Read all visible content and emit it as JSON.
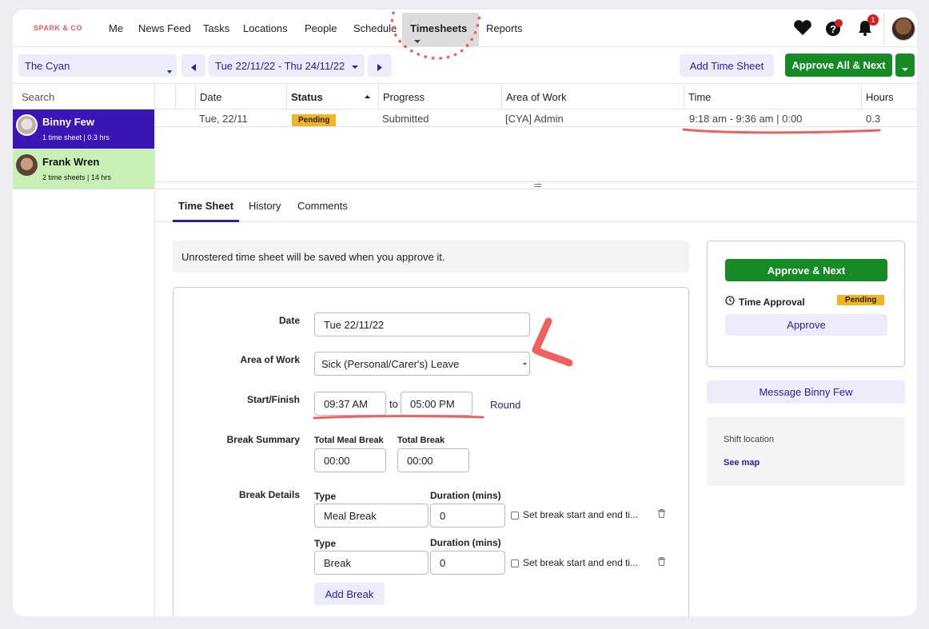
{
  "brand": "SPARK & CO",
  "nav": [
    "Me",
    "News Feed",
    "Tasks",
    "Locations",
    "People",
    "Schedule",
    "Timesheets",
    "Reports"
  ],
  "nav_active": "Timesheets",
  "notifications_count": "1",
  "toolbar": {
    "location": "The Cyan",
    "date_range": "Tue 22/11/22 - Thu 24/11/22",
    "add_time_sheet": "Add Time Sheet",
    "approve_all_next": "Approve All & Next"
  },
  "search_label": "Search",
  "people": [
    {
      "name": "Binny Few",
      "summary": "1 time sheet | 0.3 hrs"
    },
    {
      "name": "Frank Wren",
      "summary": "2 time sheets | 14 hrs"
    }
  ],
  "grid": {
    "headers": [
      "Date",
      "Status",
      "Progress",
      "Area of Work",
      "Time",
      "Hours"
    ],
    "row": {
      "date": "Tue, 22/11",
      "status": "Pending",
      "progress": "Submitted",
      "area": "[CYA] Admin",
      "time": "9:18 am - 9:36 am | 0:00",
      "hours": "0.3"
    }
  },
  "tabs": [
    "Time Sheet",
    "History",
    "Comments"
  ],
  "note": "Unrostered time sheet will be saved when you approve it.",
  "form": {
    "date_label": "Date",
    "date_value": "Tue 22/11/22",
    "area_label": "Area of Work",
    "area_value": "Sick (Personal/Carer's) Leave",
    "startfinish_label": "Start/Finish",
    "start": "09:37 AM",
    "to": "to",
    "finish": "05:00 PM",
    "round": "Round",
    "break_summary_label": "Break Summary",
    "total_meal_break_label": "Total Meal Break",
    "total_meal_break": "00:00",
    "total_break_label": "Total Break",
    "total_break": "00:00",
    "break_details_label": "Break Details",
    "breaks": [
      {
        "type_label": "Type",
        "type": "Meal Break",
        "duration_label": "Duration (mins)",
        "duration": "0",
        "checkbox_label": "Set break start and end ti..."
      },
      {
        "type_label": "Type",
        "type": "Break",
        "duration_label": "Duration (mins)",
        "duration": "0",
        "checkbox_label": "Set break start and end ti..."
      }
    ],
    "add_break": "Add Break"
  },
  "approval": {
    "approve_next": "Approve & Next",
    "time_approval": "Time Approval",
    "status": "Pending",
    "approve": "Approve"
  },
  "message_button": "Message Binny Few",
  "shift": {
    "label": "Shift location",
    "link": "See map"
  },
  "colors": {
    "accent": "#2b2299",
    "selected_person": "#3a15b8",
    "second_person": "#c9f0b4",
    "green": "#168a25",
    "pending": "#f2b422",
    "annotation": "#f0605e"
  }
}
